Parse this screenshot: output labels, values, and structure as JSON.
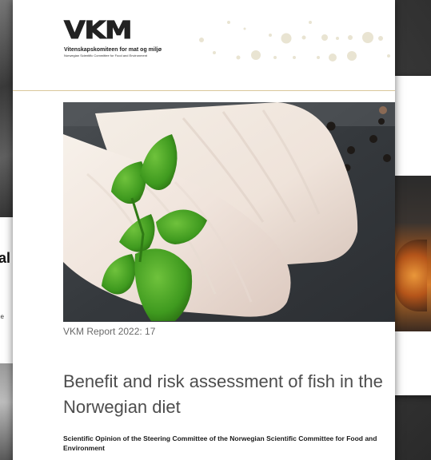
{
  "logo": {
    "mark": "VKM",
    "name": "Vitenskapskomiteen for mat og miljø",
    "tagline": "Norwegian Scientific Committee for Food and Environment"
  },
  "cover": {
    "report_number": "VKM Report 2022: 17",
    "title": "Benefit and risk assessment of fish in the Norwegian diet",
    "subtitle": "Scientific Opinion of the Steering Committee of the Norwegian Scientific Committee for Food and Environment"
  },
  "background_left_report": {
    "title_fragment": "al",
    "text_fragment": "he"
  },
  "colors": {
    "header_rule": "#d9c79a",
    "title_text": "#4d4d4d",
    "report_number_text": "#6a6a6a"
  }
}
